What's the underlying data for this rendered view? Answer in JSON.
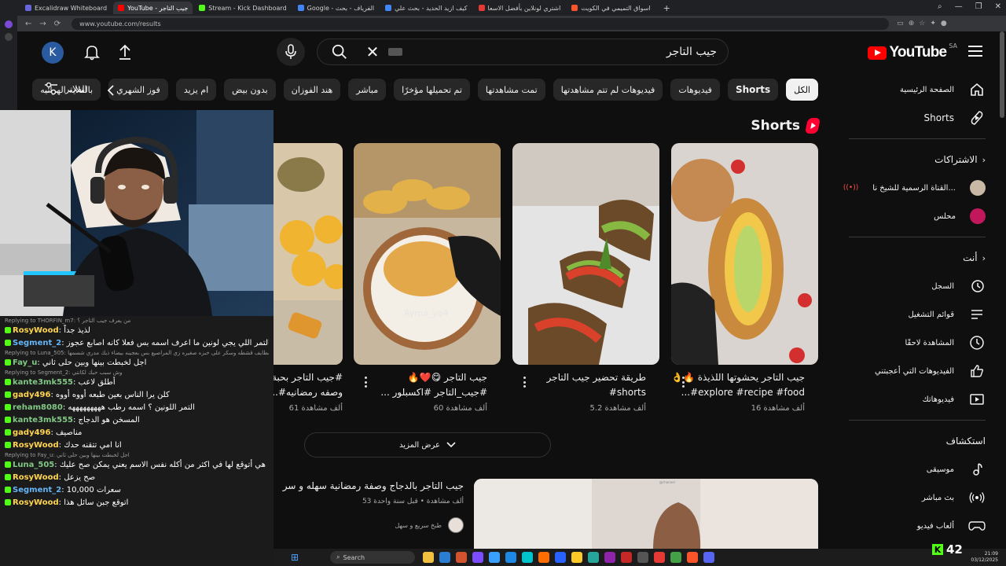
{
  "browser": {
    "tabs": [
      {
        "label": "Excalidraw Whiteboard",
        "color": "#6965db",
        "active": false
      },
      {
        "label": "YouTube - جيب التاجر",
        "color": "#ff0000",
        "active": true
      },
      {
        "label": "Stream - Kick Dashboard",
        "color": "#53fc18",
        "active": false
      },
      {
        "label": "Google - الفرياف - بحث",
        "color": "#4285f4",
        "active": false
      },
      {
        "label": "كيف ازيد الحديد - بحث علي",
        "color": "#4285f4",
        "active": false
      },
      {
        "label": "اشتري لونلاين بأفضل الاسعا",
        "color": "#e53935",
        "active": false
      },
      {
        "label": "اسواق التميمي في الكويت",
        "color": "#fb542b",
        "active": false
      }
    ],
    "url": "www.youtube.com/results",
    "new_tab": "+"
  },
  "header": {
    "logo_text": "YouTube",
    "country_code": "SA",
    "search_value": "جيب التاجر",
    "avatar_letter": "K"
  },
  "chips": {
    "items": [
      "الكل",
      "Shorts",
      "فيديوهات",
      "فيديوهات لم تتم مشاهدتها",
      "تمت مشاهدتها",
      "تم تحميلها مؤخرًا",
      "مباشر",
      "هند الفوزان",
      "بدون بيض",
      "ام يزيد",
      "فوز الشهري",
      "بالقلايه الهوائيه"
    ],
    "filters_label": "الفلاتر"
  },
  "sidebar": {
    "home": "الصفحة الرئيسية",
    "shorts": "Shorts",
    "subscriptions_heading": "الاشتراكات",
    "subscriptions": [
      "القناة الرسمية للشيخ نا...",
      "محلس"
    ],
    "you_heading": "أنت",
    "you_items": [
      "السجل",
      "قوائم التشغيل",
      "المشاهدة لاحقًا",
      "الفيديوهات التي أعجبتني",
      "فيديوهاتك"
    ],
    "explore_heading": "استكشاف",
    "explore_items": [
      "موسيقى",
      "بث مباشر",
      "ألعاب فيديو"
    ]
  },
  "shorts": {
    "heading": "Shorts",
    "items": [
      {
        "title1": "جيب التاجر يحشوتها اللذيذة 🔥👌",
        "title2": "explore #recipe #food#...",
        "views": "16 ألف مشاهدة"
      },
      {
        "title1": "طريقة تحضير جيب التاجر",
        "title2": "shorts#",
        "views": "5.2 ألف مشاهدة"
      },
      {
        "title1": "جيب التاجر 😋❤️🔥",
        "title2": "#جيب_التاجر #اكسبلور ...",
        "views": "60 ألف مشاهدة"
      },
      {
        "title1": "#جيب التاجر بحبة",
        "title2": "وصفه رمضانيه#...",
        "views": "61 ألف مشاهدة"
      }
    ],
    "watermark": "Ayma_ya4",
    "show_more": "عرض المزيد"
  },
  "video_result": {
    "title": "جيب التاجر بالدجاج وصفة رمضانية سهله و سر",
    "meta": "53 ألف مشاهدة • قبل سنة واحدة",
    "channel": "طبخ سريع و سهل"
  },
  "chat": {
    "messages": [
      {
        "reply": "Replying to THORFIN_m7: من يعرف جيب التاجر ؟",
        "user": "RosyWood",
        "text": "لذيذ جداً",
        "color": "#ffd54f"
      },
      {
        "reply": "",
        "user": "Segment_2",
        "text": "التمر اللي يجي لونين ما اعرف اسمه بس فعلا كانه اصابع عجوز",
        "color": "#64b5f6"
      },
      {
        "reply": "Replying to Luna_505: لا القطايف قشطه وسكر على خبزه صغيره زي المراصيع بس بعجينه بيضاء ذيك مدري شسمها",
        "user": "Fay_u",
        "text": "اجل لخبطت بينها وبين حلى ثاني",
        "color": "#81c784"
      },
      {
        "reply": "Replying to Segment_2: وش سبب حبك لكانتي",
        "user": "kante3mk555",
        "text": "أطلق لاعب",
        "color": "#81c784"
      },
      {
        "reply": "",
        "user": "gady496",
        "text": "كلن يرا الناس بعين طبعه أووه أووه",
        "color": "#ffd54f"
      },
      {
        "reply": "",
        "user": "reham8080",
        "text": "التمر اللونين ؟ اسمه رطب هههههههههه",
        "color": "#81c784"
      },
      {
        "reply": "",
        "user": "kante3mk555",
        "text": "المسخن هو الدجاج",
        "color": "#81c784"
      },
      {
        "reply": "",
        "user": "gady496",
        "text": "مناصيف",
        "color": "#ffd54f"
      },
      {
        "reply": "",
        "user": "RosyWood",
        "text": "انا امي تتقنه حدك",
        "color": "#ffd54f"
      },
      {
        "reply": "Replying to Fay_u: اجل لخبطت بينها وبين حلى ثاني",
        "user": "Luna_505",
        "text": "هي أتوقع لها في اكثر من أكله نفس الاسم يعني يمكن صح عليك",
        "color": "#81c784"
      },
      {
        "reply": "",
        "user": "RosyWood",
        "text": "صح يزعل",
        "color": "#ffd54f"
      },
      {
        "reply": "",
        "user": "Segment_2",
        "text": "سعرات 10,000",
        "color": "#64b5f6"
      },
      {
        "reply": "",
        "user": "RosyWood",
        "text": "اتوقع جبن سائل هذا",
        "color": "#ffd54f"
      }
    ]
  },
  "taskbar": {
    "search_label": "Search",
    "time": "21:09",
    "date": "03/12/2025"
  },
  "kick": {
    "viewer_count": "42"
  }
}
